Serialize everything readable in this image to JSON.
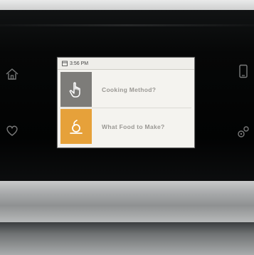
{
  "screen": {
    "status_time": "3:56 PM",
    "menu": [
      {
        "label": "Cooking Method?",
        "icon": "hand-pointer-icon",
        "tile_color": "#7d7c79"
      },
      {
        "label": "What Food to Make?",
        "icon": "food-dish-icon",
        "tile_color": "#e6a13a"
      }
    ]
  },
  "side_controls": {
    "left": [
      "home-icon",
      "heart-icon"
    ],
    "right": [
      "phone-icon",
      "settings-gear-icon"
    ]
  },
  "colors": {
    "panel": "#050606",
    "screen_bg": "#f4f3ef",
    "accent_orange": "#e6a13a",
    "accent_gray": "#7d7c79"
  }
}
